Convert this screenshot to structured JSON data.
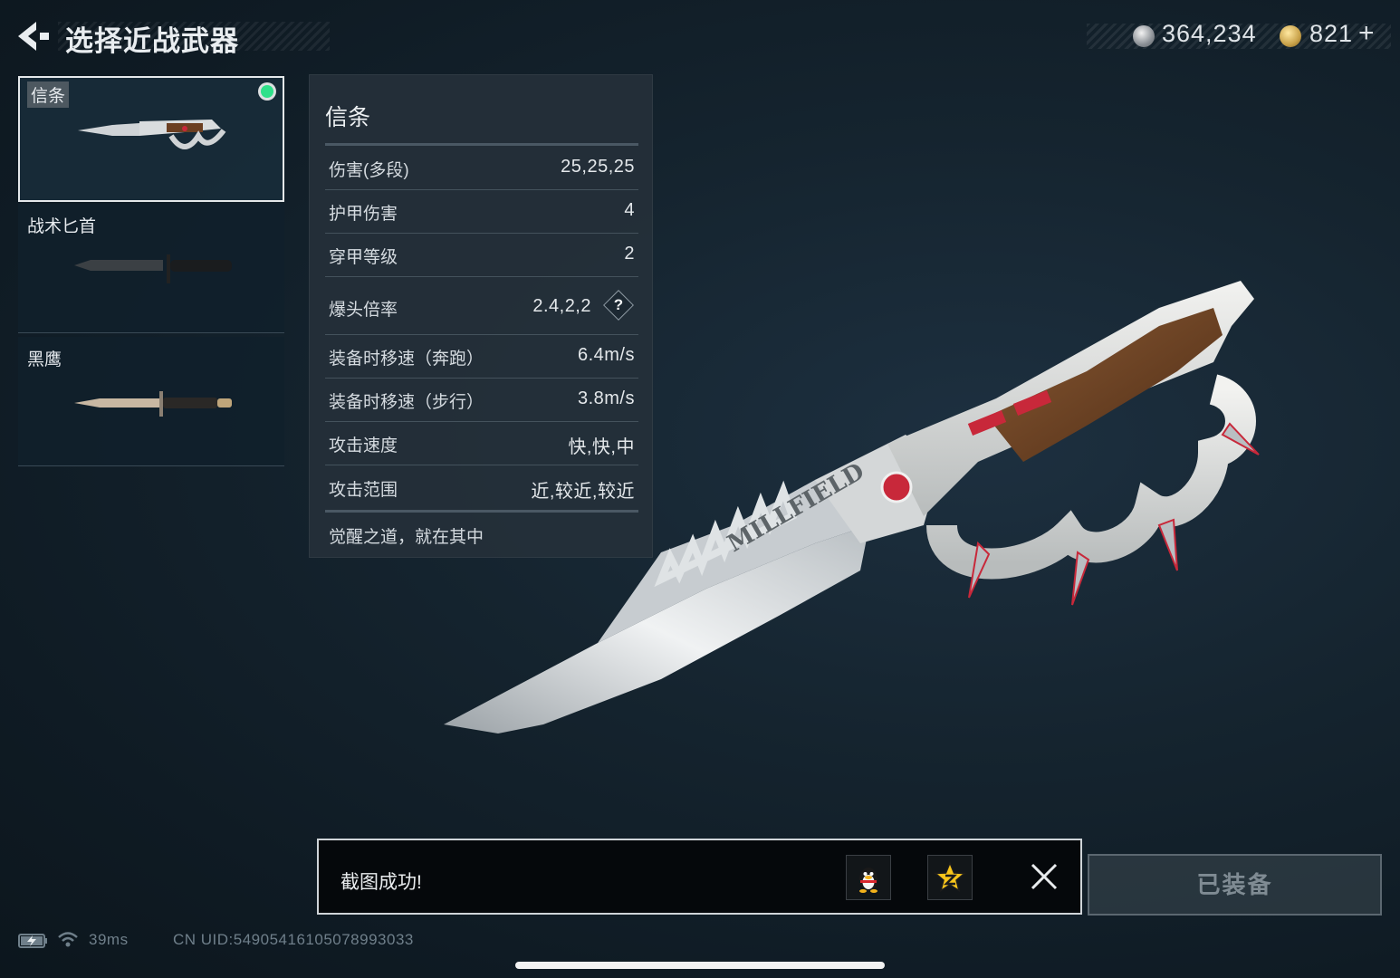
{
  "header": {
    "title": "选择近战武器"
  },
  "currency": {
    "silver_amount": "364,234",
    "gold_amount": "821",
    "gold_add_symbol": "+"
  },
  "weapons": [
    {
      "name": "信条",
      "selected": true,
      "equipped": true
    },
    {
      "name": "战术匕首",
      "selected": false,
      "equipped": false
    },
    {
      "name": "黑鹰",
      "selected": false,
      "equipped": false
    }
  ],
  "stats": {
    "title": "信条",
    "rows": [
      {
        "label": "伤害(多段)",
        "value": "25,25,25"
      },
      {
        "label": "护甲伤害",
        "value": "4"
      },
      {
        "label": "穿甲等级",
        "value": "2"
      },
      {
        "label": "爆头倍率",
        "value": "2.4,2,2",
        "help": "?"
      },
      {
        "label": "装备时移速（奔跑）",
        "value": "6.4m/s"
      },
      {
        "label": "装备时移速（步行）",
        "value": "3.8m/s"
      },
      {
        "label": "攻击速度",
        "value": "快,快,中"
      },
      {
        "label": "攻击范围",
        "value": "近,较近,较近"
      }
    ],
    "description": "觉醒之道，就在其中"
  },
  "weapon_engraving": "MILLFIELD",
  "toast": {
    "message": "截图成功!"
  },
  "equip_button": {
    "label": "已装备"
  },
  "status_bar": {
    "ping": "39ms",
    "uid": "CN UID:54905416105078993033"
  },
  "colors": {
    "background": "#15242f",
    "equipped_dot": "#2fe08a",
    "panel": "#25303a",
    "accent_red": "#c8283a"
  }
}
